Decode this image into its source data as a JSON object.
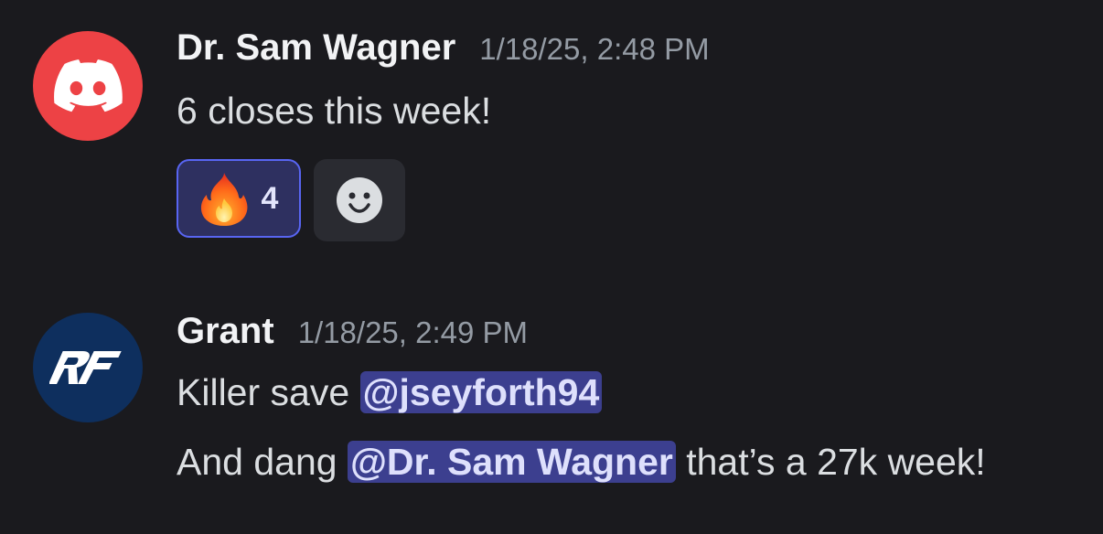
{
  "messages": [
    {
      "username": "Dr. Sam Wagner",
      "timestamp": "1/18/25, 2:48 PM",
      "avatar_icon": "discord-logo-icon",
      "avatar_color": "#ed4245",
      "text": "6 closes this week!",
      "reactions": [
        {
          "emoji": "fire-emoji",
          "count": "4",
          "active": true
        }
      ],
      "add_reaction_icon": "smiley-add-reaction-icon"
    },
    {
      "username": "Grant",
      "timestamp": "1/18/25, 2:49 PM",
      "avatar_icon": "rf-logo-icon",
      "avatar_color": "#0e2f5e",
      "avatar_text": "RF",
      "line1_prefix": "Killer save ",
      "line1_mention": "@jseyforth94",
      "line2_prefix": "And dang ",
      "line2_mention": "@Dr. Sam Wagner",
      "line2_suffix": " that’s a  27k week!"
    }
  ],
  "colors": {
    "background": "#1a1a1e",
    "mention_bg": "#3c3f8f",
    "reaction_border": "#5865f2"
  }
}
